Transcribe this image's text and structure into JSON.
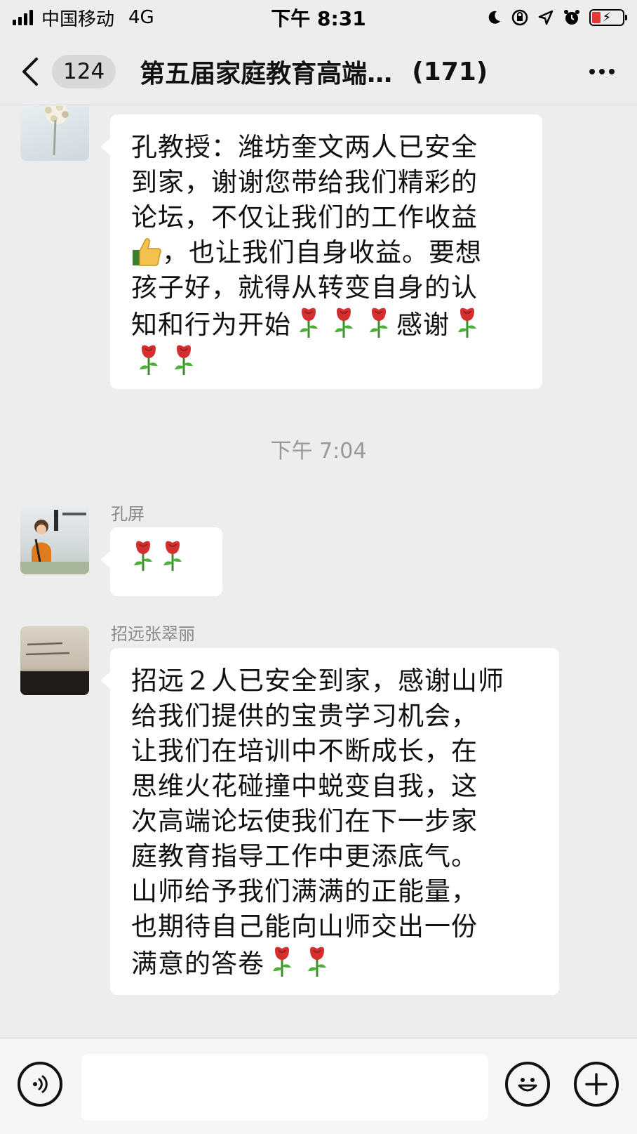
{
  "status_bar": {
    "carrier": "中国移动",
    "network": "4G",
    "time": "下午 8:31"
  },
  "nav": {
    "unread_count": "124",
    "title": "第五届家庭教育高端…",
    "member_count": "(171)"
  },
  "messages": [
    {
      "sender": "",
      "text_parts": [
        "孔教授：潍坊奎文两人已安全",
        "到家，谢谢您带给我们精彩的",
        "论坛，不仅让我们的工作收益",
        "，也让我们自身收益。要想",
        "孩子好，就得从转变自身的认",
        "知和行为开始",
        "感谢"
      ]
    },
    {
      "sender": "孔屏",
      "text_parts": []
    },
    {
      "sender": "招远张翠丽",
      "text_parts": [
        "招远２人已安全到家，感谢山师",
        "给我们提供的宝贵学习机会，",
        "让我们在培训中不断成长，在",
        "思维火花碰撞中蜕变自我，这",
        "次高端论坛使我们在下一步家",
        "庭教育指导工作中更添底气。",
        "山师给予我们满满的正能量，",
        "也期待自己能向山师交出一份",
        "满意的答卷"
      ]
    }
  ],
  "timestamp": "下午 7:04",
  "icons": {
    "rose": "rose-icon",
    "thumbs_up": "thumbs-up-icon"
  },
  "colors": {
    "background": "#ededed",
    "bubble": "#ffffff",
    "battery_low": "#e53935"
  }
}
